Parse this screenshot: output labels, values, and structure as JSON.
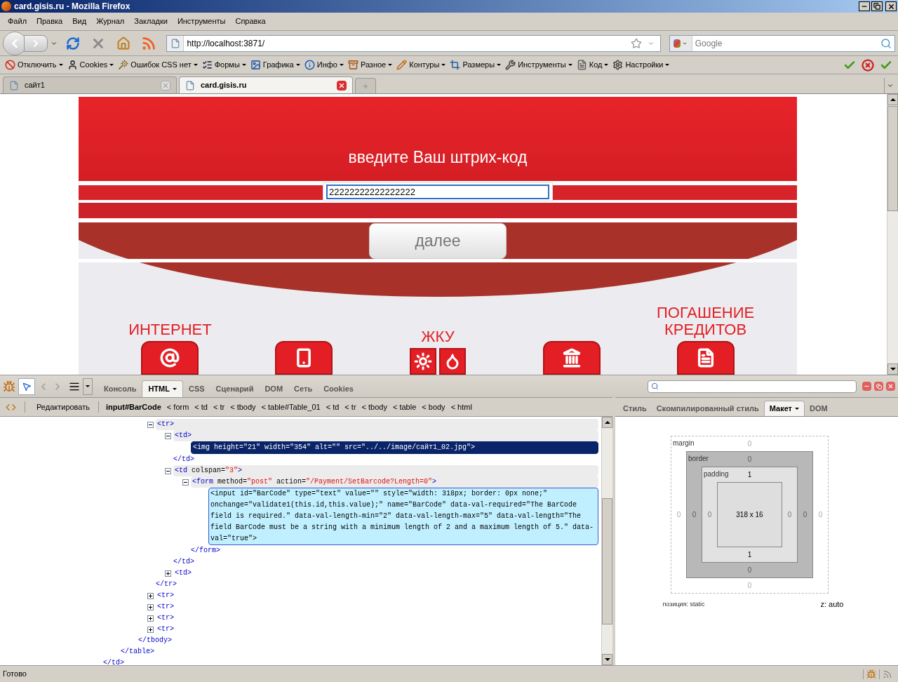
{
  "window": {
    "title": "card.gisis.ru - Mozilla Firefox"
  },
  "menu": [
    "Файл",
    "Правка",
    "Вид",
    "Журнал",
    "Закладки",
    "Инструменты",
    "Справка"
  ],
  "navigation": {
    "url": "http://localhost:3871/",
    "search_placeholder": "Google"
  },
  "addon_toolbar": [
    {
      "label": "Отключить",
      "kind": "disable"
    },
    {
      "label": "Cookies",
      "kind": "cookies"
    },
    {
      "label": "Ошибок CSS нет",
      "kind": "css"
    },
    {
      "label": "Формы",
      "kind": "forms"
    },
    {
      "label": "Графика",
      "kind": "images"
    },
    {
      "label": "Инфо",
      "kind": "info"
    },
    {
      "label": "Разное",
      "kind": "misc"
    },
    {
      "label": "Контуры",
      "kind": "outline"
    },
    {
      "label": "Размеры",
      "kind": "resize"
    },
    {
      "label": "Инструменты",
      "kind": "tools"
    },
    {
      "label": "Код",
      "kind": "source"
    },
    {
      "label": "Настройки",
      "kind": "options"
    }
  ],
  "tabs": [
    {
      "label": "сайт1",
      "selected": false
    },
    {
      "label": "card.gisis.ru",
      "selected": true
    }
  ],
  "page": {
    "heading": "введите Ваш штрих-код",
    "barcode_value": "22222222222222222",
    "button": "далее",
    "categories": [
      {
        "kind": "internet",
        "label": "ИНТЕРНЕТ"
      },
      {
        "kind": "phone"
      },
      {
        "kind": "utilities",
        "label": "ЖКУ"
      },
      {
        "kind": "bank"
      },
      {
        "kind": "credit",
        "label": "ПОГАШЕНИЕ КРЕДИТОВ"
      }
    ]
  },
  "devtools": {
    "tabs": [
      {
        "label": "Консоль",
        "selected": false
      },
      {
        "label": "HTML",
        "selected": true
      },
      {
        "label": "CSS",
        "selected": false
      },
      {
        "label": "Сценарий",
        "selected": false
      },
      {
        "label": "DOM",
        "selected": false
      },
      {
        "label": "Сеть",
        "selected": false
      },
      {
        "label": "Cookies",
        "selected": false
      }
    ],
    "edit_button": "Редактировать",
    "breadcrumbs": [
      {
        "label": "input#BarCode",
        "selected": true
      },
      {
        "label": "< form",
        "selected": false
      },
      {
        "label": "< td",
        "selected": false
      },
      {
        "label": "< tr",
        "selected": false
      },
      {
        "label": "< tbody",
        "selected": false
      },
      {
        "label": "< table#Table_01",
        "selected": false
      },
      {
        "label": "< td",
        "selected": false
      },
      {
        "label": "< tr",
        "selected": false
      },
      {
        "label": "< tbody",
        "selected": false
      },
      {
        "label": "< table",
        "selected": false
      },
      {
        "label": "< body",
        "selected": false
      },
      {
        "label": "< html",
        "selected": false
      }
    ],
    "tree": [
      {
        "close": "</td>",
        "children": [
          {
            "close": "</table>",
            "children": [
              {
                "close": "</tbody>",
                "children": [
                  {
                    "open": "<tr>",
                    "expanded": true,
                    "selected": false,
                    "inspected": false,
                    "close": "</tr>",
                    "children": [
                      {
                        "open": "<td>",
                        "expanded": true,
                        "selected": false,
                        "inspected": false,
                        "close": "</td>",
                        "children": [
                          {
                            "open": "<img height=\"21\" width=\"354\" alt=\"\" src=\"../../image/сайт1_02.jpg\">",
                            "selected": true,
                            "inspected": false
                          }
                        ]
                      },
                      {
                        "open": "<td colspan=\"3\">",
                        "expanded": true,
                        "selected": false,
                        "inspected": false,
                        "close": "</td>",
                        "children": [
                          {
                            "open": "<form method=\"post\" action=\"/Payment/SetBarcode?Length=0\">",
                            "expanded": true,
                            "selected": false,
                            "inspected": false,
                            "close": "</form>",
                            "children": [
                              {
                                "open": "<input id=\"BarCode\" type=\"text\" value=\"\" style=\"width: 318px; border: 0px none;\" onchange=\"validate1(this.id,this.value);\" name=\"BarCode\" data-val-required=\"The BarCode field is required.\" data-val-length-min=\"2\" data-val-length-max=\"5\" data-val-length=\"The field BarCode must be a string with a minimum length of 2 and a maximum length of 5.\" data-val=\"true\">",
                                "selected": false,
                                "inspected": true
                              }
                            ]
                          }
                        ]
                      },
                      {
                        "open": "<td>",
                        "expanded": false,
                        "selected": false,
                        "inspected": false
                      }
                    ]
                  },
                  {
                    "open": "<tr>",
                    "expanded": false,
                    "selected": false,
                    "inspected": false
                  },
                  {
                    "open": "<tr>",
                    "expanded": false,
                    "selected": false,
                    "inspected": false
                  },
                  {
                    "open": "<tr>",
                    "expanded": false,
                    "selected": false,
                    "inspected": false
                  },
                  {
                    "open": "<tr>",
                    "expanded": false,
                    "selected": false,
                    "inspected": false
                  }
                ]
              }
            ]
          }
        ]
      }
    ],
    "side_tabs": [
      {
        "label": "Стиль",
        "selected": false
      },
      {
        "label": "Скомпилированный стиль",
        "selected": false
      },
      {
        "label": "Макет",
        "selected": true
      },
      {
        "label": "DOM",
        "selected": false
      }
    ],
    "layout": {
      "margin": {
        "label": "margin",
        "top": {
          "text": "0",
          "dim": true
        },
        "right": {
          "text": "0",
          "dim": true
        },
        "bottom": {
          "text": "0",
          "dim": true
        },
        "left": {
          "text": "0",
          "dim": true
        }
      },
      "border": {
        "label": "border",
        "top": {
          "text": "0",
          "dim": true
        },
        "right": {
          "text": "0",
          "dim": true
        },
        "bottom": {
          "text": "0",
          "dim": true
        },
        "left": {
          "text": "0",
          "dim": true
        }
      },
      "padding": {
        "label": "padding",
        "top": {
          "text": "1",
          "dim": false
        },
        "right": {
          "text": "0",
          "dim": true
        },
        "bottom": {
          "text": "1",
          "dim": false
        },
        "left": {
          "text": "0",
          "dim": true
        }
      },
      "content": "318 x 16",
      "position": "позиция: static",
      "z_index": "z: auto"
    }
  },
  "status_bar": "Готово"
}
